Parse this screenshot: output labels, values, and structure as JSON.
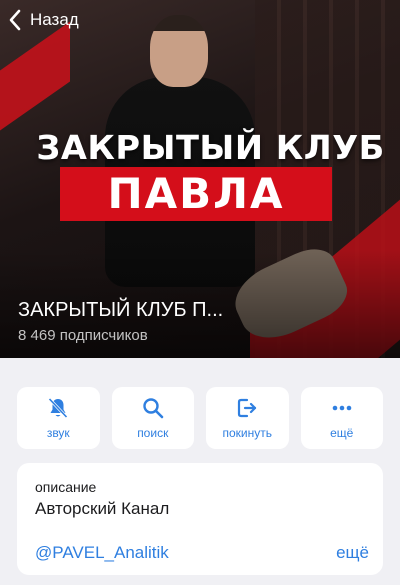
{
  "nav": {
    "back_label": "Назад"
  },
  "cover": {
    "line1": "ЗАКРЫТЫЙ КЛУБ",
    "line2": "ПАВЛА",
    "accent_color": "#d40e1a"
  },
  "channel": {
    "name": "ЗАКРЫТЫЙ КЛУБ П...",
    "subscribers": "8 469 подписчиков"
  },
  "actions": [
    {
      "label": "звук",
      "icon": "bell-slash-icon"
    },
    {
      "label": "поиск",
      "icon": "search-icon"
    },
    {
      "label": "покинуть",
      "icon": "leave-icon"
    },
    {
      "label": "ещё",
      "icon": "more-dots-icon"
    }
  ],
  "info": {
    "label": "описание",
    "value": "Авторский Канал",
    "username": "@PAVEL_Analitik",
    "more": "ещё"
  },
  "colors": {
    "link": "#2f7fe0",
    "background": "#f0f0f4"
  }
}
